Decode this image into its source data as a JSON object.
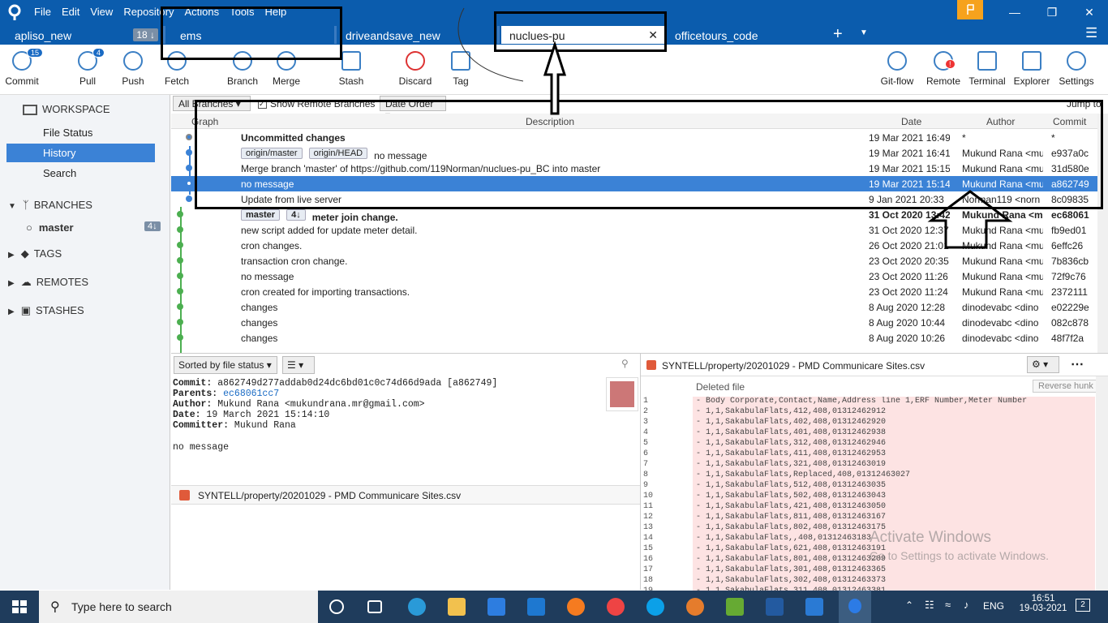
{
  "menu": [
    "File",
    "Edit",
    "View",
    "Repository",
    "Actions",
    "Tools",
    "Help"
  ],
  "tabs": [
    {
      "label": "apliso_new",
      "badge": "18 ↓"
    },
    {
      "label": "ems"
    },
    {
      "label": "driveandsave_new"
    },
    {
      "label": "nuclues-pu"
    },
    {
      "label": "officetours_code"
    }
  ],
  "toolbar": {
    "commit": "Commit",
    "commit_badge": "15",
    "pull": "Pull",
    "pull_badge": "4",
    "push": "Push",
    "fetch": "Fetch",
    "branch": "Branch",
    "merge": "Merge",
    "stash": "Stash",
    "discard": "Discard",
    "tag": "Tag",
    "gitflow": "Git-flow",
    "remote": "Remote",
    "terminal": "Terminal",
    "explorer": "Explorer",
    "settings": "Settings"
  },
  "sidebar": {
    "workspace": "WORKSPACE",
    "file_status": "File Status",
    "history": "History",
    "search": "Search",
    "branches": "BRANCHES",
    "master": "master",
    "master_badge": "4↓",
    "tags": "TAGS",
    "remotes": "REMOTES",
    "stashes": "STASHES"
  },
  "filter": {
    "branches": "All Branches",
    "show_remote": "Show Remote Branches",
    "order": "Date Order",
    "jump": "Jump to:"
  },
  "columns": {
    "graph": "Graph",
    "description": "Description",
    "date": "Date",
    "author": "Author",
    "commit": "Commit"
  },
  "commits": [
    {
      "desc": "Uncommitted changes",
      "date": "19 Mar 2021 16:49",
      "author": "*",
      "hash": "*",
      "bold": true
    },
    {
      "tags": [
        "origin/master",
        "origin/HEAD"
      ],
      "desc": "no message",
      "date": "19 Mar 2021 16:41",
      "author": "Mukund Rana <mu",
      "hash": "e937a0c"
    },
    {
      "desc": "Merge branch 'master' of https://github.com/119Norman/nuclues-pu_BC into master",
      "date": "19 Mar 2021 15:15",
      "author": "Mukund Rana <mu",
      "hash": "31d580e"
    },
    {
      "desc": "no message",
      "date": "19 Mar 2021 15:14",
      "author": "Mukund Rana <mu",
      "hash": "a862749",
      "selected": true
    },
    {
      "desc": "Update from live server",
      "date": "9 Jan 2021 20:33",
      "author": "Norman119 <norn",
      "hash": "8c09835"
    },
    {
      "tags": [
        "master",
        "4↓"
      ],
      "desc": "meter join change.",
      "date": "31 Oct 2020 13:42",
      "author": "Mukund Rana <m",
      "hash": "ec68061",
      "bold": true
    },
    {
      "desc": "new script added for update meter detail.",
      "date": "31 Oct 2020 12:37",
      "author": "Mukund Rana <mu",
      "hash": "fb9ed01"
    },
    {
      "desc": "cron changes.",
      "date": "26 Oct 2020 21:01",
      "author": "Mukund Rana <mu",
      "hash": "6effc26"
    },
    {
      "desc": "transaction cron change.",
      "date": "23 Oct 2020 20:35",
      "author": "Mukund Rana <mu",
      "hash": "7b836cb"
    },
    {
      "desc": "no message",
      "date": "23 Oct 2020 11:26",
      "author": "Mukund Rana <mu",
      "hash": "72f9c76"
    },
    {
      "desc": "cron created for importing transactions.",
      "date": "23 Oct 2020 11:24",
      "author": "Mukund Rana <mu",
      "hash": "2372111"
    },
    {
      "desc": "changes",
      "date": "8 Aug 2020 12:28",
      "author": "dinodevabc <dino",
      "hash": "e02229e"
    },
    {
      "desc": "changes",
      "date": "8 Aug 2020 10:44",
      "author": "dinodevabc <dino",
      "hash": "082c878"
    },
    {
      "desc": "changes",
      "date": "8 Aug 2020 10:26",
      "author": "dinodevabc <dino",
      "hash": "48f7f2a"
    }
  ],
  "details": {
    "sort": "Sorted by file status",
    "commit_label": "Commit:",
    "commit": "a862749d277addab0d24dc6bd01c0c74d66d9ada [a862749]",
    "parents_label": "Parents:",
    "parents": "ec68061cc7",
    "author_label": "Author:",
    "author": "Mukund Rana <mukundrana.mr@gmail.com>",
    "date_label": "Date:",
    "date": "19 March 2021 15:14:10",
    "committer_label": "Committer:",
    "committer": "Mukund Rana",
    "message": "no message",
    "file": "SYNTELL/property/20201029 - PMD Communicare Sites.csv"
  },
  "diff": {
    "file": "SYNTELL/property/20201029 - PMD Communicare Sites.csv",
    "status": "Deleted file",
    "reverse": "Reverse hunk",
    "lines": [
      "- Body Corporate,Contact,Name,Address line 1,ERF Number,Meter Number",
      "- 1,1,SakabulaFlats,412,408,01312462912",
      "- 1,1,SakabulaFlats,402,408,01312462920",
      "- 1,1,SakabulaFlats,401,408,01312462938",
      "- 1,1,SakabulaFlats,312,408,01312462946",
      "- 1,1,SakabulaFlats,411,408,01312462953",
      "- 1,1,SakabulaFlats,321,408,01312463019",
      "- 1,1,SakabulaFlats,Replaced,408,01312463027",
      "- 1,1,SakabulaFlats,512,408,01312463035",
      "- 1,1,SakabulaFlats,502,408,01312463043",
      "- 1,1,SakabulaFlats,421,408,01312463050",
      "- 1,1,SakabulaFlats,811,408,01312463167",
      "- 1,1,SakabulaFlats,802,408,01312463175",
      "- 1,1,SakabulaFlats,,408,01312463183",
      "- 1,1,SakabulaFlats,621,408,01312463191",
      "- 1,1,SakabulaFlats,801,408,01312463209",
      "- 1,1,SakabulaFlats,301,408,01312463365",
      "- 1,1,SakabulaFlats,302,408,01312463373",
      "- 1,1,SakabulaFlats,311,408,01312463381"
    ]
  },
  "watermark": {
    "title": "Activate Windows",
    "sub": "Go to Settings to activate Windows."
  },
  "taskbar": {
    "search": "Type here to search",
    "lang": "ENG",
    "time": "16:51",
    "date": "19-03-2021",
    "notif": "2"
  }
}
